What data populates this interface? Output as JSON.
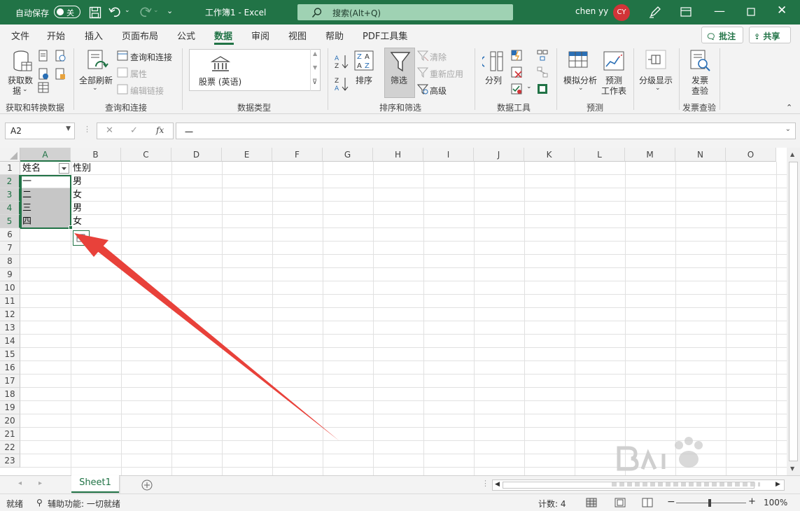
{
  "titlebar": {
    "autosave_label": "自动保存",
    "autosave_state": "关",
    "doc_title": "工作簿1  -  Excel",
    "search_placeholder": "搜索(Alt+Q)",
    "user_name": "chen yy",
    "avatar_initials": "CY",
    "accent_color": "#217346"
  },
  "menu": {
    "tabs": [
      "文件",
      "开始",
      "插入",
      "页面布局",
      "公式",
      "数据",
      "审阅",
      "视图",
      "帮助",
      "PDF工具集"
    ],
    "active_tab": "数据",
    "comment_button": "批注",
    "share_button": "共享"
  },
  "ribbon": {
    "get_data": "获取数\n据",
    "get_data_line1": "获取数",
    "get_data_line2": "据",
    "group_get_transform": "获取和转换数据",
    "refresh_all": "全部刷新",
    "queries_connections": "查询和连接",
    "properties": "属性",
    "edit_links": "编辑链接",
    "group_queries": "查询和连接",
    "datatype_stock": "股票 (英语)",
    "group_datatypes": "数据类型",
    "sort": "排序",
    "filter": "筛选",
    "clear": "清除",
    "reapply": "重新应用",
    "advanced": "高级",
    "group_sort_filter": "排序和筛选",
    "text_to_columns": "分列",
    "group_data_tools": "数据工具",
    "what_if": "模拟分析",
    "forecast_sheet_line1": "预测",
    "forecast_sheet_line2": "工作表",
    "group_forecast": "预测",
    "outline": "分级显示",
    "invoice_line1": "发票",
    "invoice_line2": "查验",
    "group_invoice": "发票查验"
  },
  "formula_bar": {
    "name_box": "A2",
    "formula_value": "一"
  },
  "sheet": {
    "columns": [
      "A",
      "B",
      "C",
      "D",
      "E",
      "F",
      "G",
      "H",
      "I",
      "J",
      "K",
      "L",
      "M",
      "N",
      "O"
    ],
    "rows": [
      "1",
      "2",
      "3",
      "4",
      "5",
      "6",
      "7",
      "8",
      "9",
      "10",
      "11",
      "12",
      "13",
      "14",
      "15",
      "16",
      "17",
      "18",
      "19",
      "20",
      "21",
      "22",
      "23"
    ],
    "header_a": "姓名",
    "header_b": "性别",
    "col_a": [
      "一",
      "二",
      "三",
      "四"
    ],
    "col_b": [
      "男",
      "女",
      "男",
      "女"
    ],
    "selected_range": "A2:A5"
  },
  "sheet_tabs": {
    "active": "Sheet1"
  },
  "status": {
    "ready": "就绪",
    "accessibility": "辅助功能: 一切就绪",
    "count": "计数: 4",
    "zoom": "100%"
  }
}
